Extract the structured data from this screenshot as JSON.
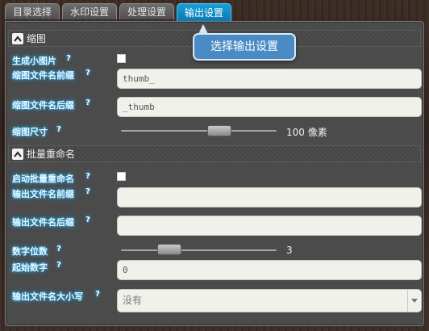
{
  "tabs": [
    {
      "label": "目录选择",
      "active": false
    },
    {
      "label": "水印设置",
      "active": false
    },
    {
      "label": "处理设置",
      "active": false
    },
    {
      "label": "输出设置",
      "active": true
    }
  ],
  "tooltip": {
    "text": "选择输出设置"
  },
  "thumbnail_section": {
    "title": "缩图",
    "generate_label": "生成小图片",
    "generate_checked": false,
    "prefix_label": "缩图文件名前缀",
    "prefix_value": "thumb_",
    "suffix_label": "缩图文件名后缀",
    "suffix_value": "_thumb",
    "size_label": "缩图尺寸",
    "size_value_text": "100 像素"
  },
  "rename_section": {
    "title": "批量重命名",
    "enable_label": "启动批量重命名",
    "enable_checked": false,
    "out_prefix_label": "输出文件名前缀",
    "out_prefix_value": "",
    "out_suffix_label": "输出文件名后缀",
    "out_suffix_value": "",
    "digits_label": "数字位数",
    "digits_value_text": "3",
    "start_label": "起始数字",
    "start_value": "0",
    "case_label": "输出文件名大小写",
    "case_selected": "没有"
  },
  "help_glyph": "?",
  "colors": {
    "active_tab": "#0b78b4",
    "label_glow": "#1ba1e2",
    "tooltip_bg": "#4b8bc5"
  },
  "icons": {
    "section_toggle": "chevron-up-icon",
    "select_arrow": "caret-down-icon"
  }
}
